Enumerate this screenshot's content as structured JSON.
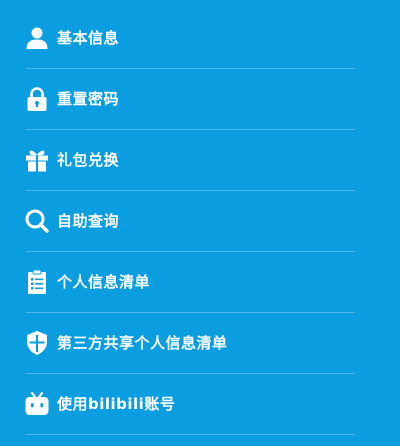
{
  "colors": {
    "background": "#0a9de0",
    "text": "#ffffff",
    "divider": "rgba(255,255,255,0.28)"
  },
  "menu": {
    "items": [
      {
        "label": "基本信息",
        "icon": "user-icon"
      },
      {
        "label": "重置密码",
        "icon": "lock-icon"
      },
      {
        "label": "礼包兑换",
        "icon": "gift-icon"
      },
      {
        "label": "自助查询",
        "icon": "search-icon"
      },
      {
        "label": "个人信息清单",
        "icon": "clipboard-list-icon"
      },
      {
        "label": "第三方共享个人信息清单",
        "icon": "shield-icon"
      },
      {
        "label": "使用bilibili账号",
        "icon": "bilibili-tv-icon"
      }
    ]
  }
}
